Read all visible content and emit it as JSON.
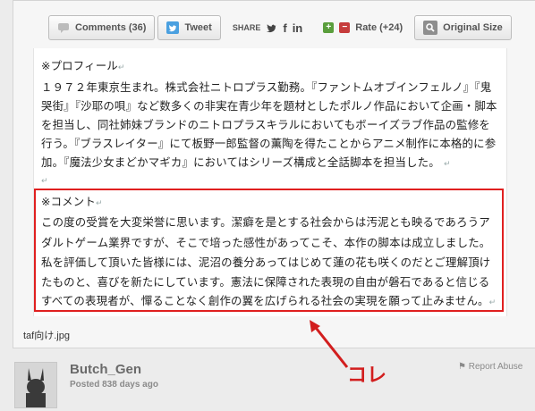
{
  "toolbar": {
    "comments_label": "Comments (36)",
    "tweet_label": "Tweet",
    "share_label": "SHARE",
    "rate_label": "Rate (+24)",
    "original_size_label": "Original Size"
  },
  "document": {
    "profile_heading": "※プロフィール",
    "profile_lines": [
      "１９７２年東京生まれ。株式会社ニトロプラス勤務。『ファントムオブインフェルノ』『鬼",
      "哭街』『沙耶の唄』など数多くの非実在青少年を題材としたポルノ作品において企画・脚本",
      "を担当し、同社姉妹ブランドのニトロプラスキラルにおいてもボーイズラブ作品の監修を",
      "行う。『ブラスレイター』にて板野一郎監督の薫陶を得たことからアニメ制作に本格的に参",
      "加。『魔法少女まどかマギカ』においてはシリーズ構成と全話脚本を担当した。"
    ],
    "comment_heading": "※コメント",
    "comment_lines": [
      "この度の受賞を大変栄誉に思います。潔癖を是とする社会からは汚泥とも映るであろうア",
      "ダルトゲーム業界ですが、そこで培った感性があってこそ、本作の脚本は成立しました。",
      "私を評価して頂いた皆様には、泥沼の養分あってはじめて蓮の花も咲くのだとご理解頂け",
      "たものと、喜びを新たにしています。憲法に保障された表現の自由が磐石であると信じる",
      "すべての表現者が、憚ることなく創作の翼を広げられる社会の実現を願って止みません。"
    ]
  },
  "filename": "taf向け.jpg",
  "post": {
    "username": "Butch_Gen",
    "posted": "Posted 838 days ago",
    "report_label": "Report Abuse"
  },
  "annotation_label": "コレ",
  "colors": {
    "annotation": "#d21e1e",
    "twitter": "#4aa0e0"
  }
}
